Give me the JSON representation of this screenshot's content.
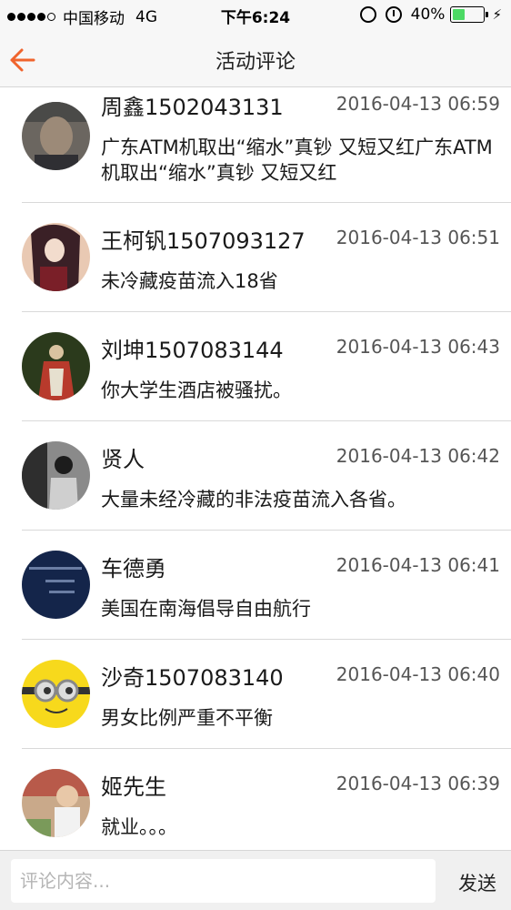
{
  "status_bar": {
    "carrier": "中国移动",
    "network": "4G",
    "time": "下午6:24",
    "battery_percent": "40%",
    "battery_level": 0.4,
    "signal_dots": [
      true,
      true,
      true,
      true,
      false
    ]
  },
  "nav": {
    "title": "活动评论",
    "back_icon": "back-arrow-icon",
    "accent_color": "#f0642d"
  },
  "comments": [
    {
      "name": "周鑫1502043131",
      "time": "2016-04-13 06:59",
      "content": "广东ATM机取出“缩水”真钞 又短又红广东ATM机取出“缩水”真钞 又短又红"
    },
    {
      "name": "王柯钒1507093127",
      "time": "2016-04-13 06:51",
      "content": "未冷藏疫苗流入18省"
    },
    {
      "name": "刘坤1507083144",
      "time": "2016-04-13 06:43",
      "content": "你大学生酒店被骚扰。"
    },
    {
      "name": "贤人",
      "time": "2016-04-13 06:42",
      "content": "大量未经冷藏的非法疫苗流入各省。"
    },
    {
      "name": "车德勇",
      "time": "2016-04-13 06:41",
      "content": "美国在南海倡导自由航行"
    },
    {
      "name": "沙奇1507083140",
      "time": "2016-04-13 06:40",
      "content": "男女比例严重不平衡"
    },
    {
      "name": "姬先生",
      "time": "2016-04-13 06:39",
      "content": "就业。。。"
    }
  ],
  "input_bar": {
    "placeholder": "评论内容...",
    "value": "",
    "send_label": "发送"
  }
}
